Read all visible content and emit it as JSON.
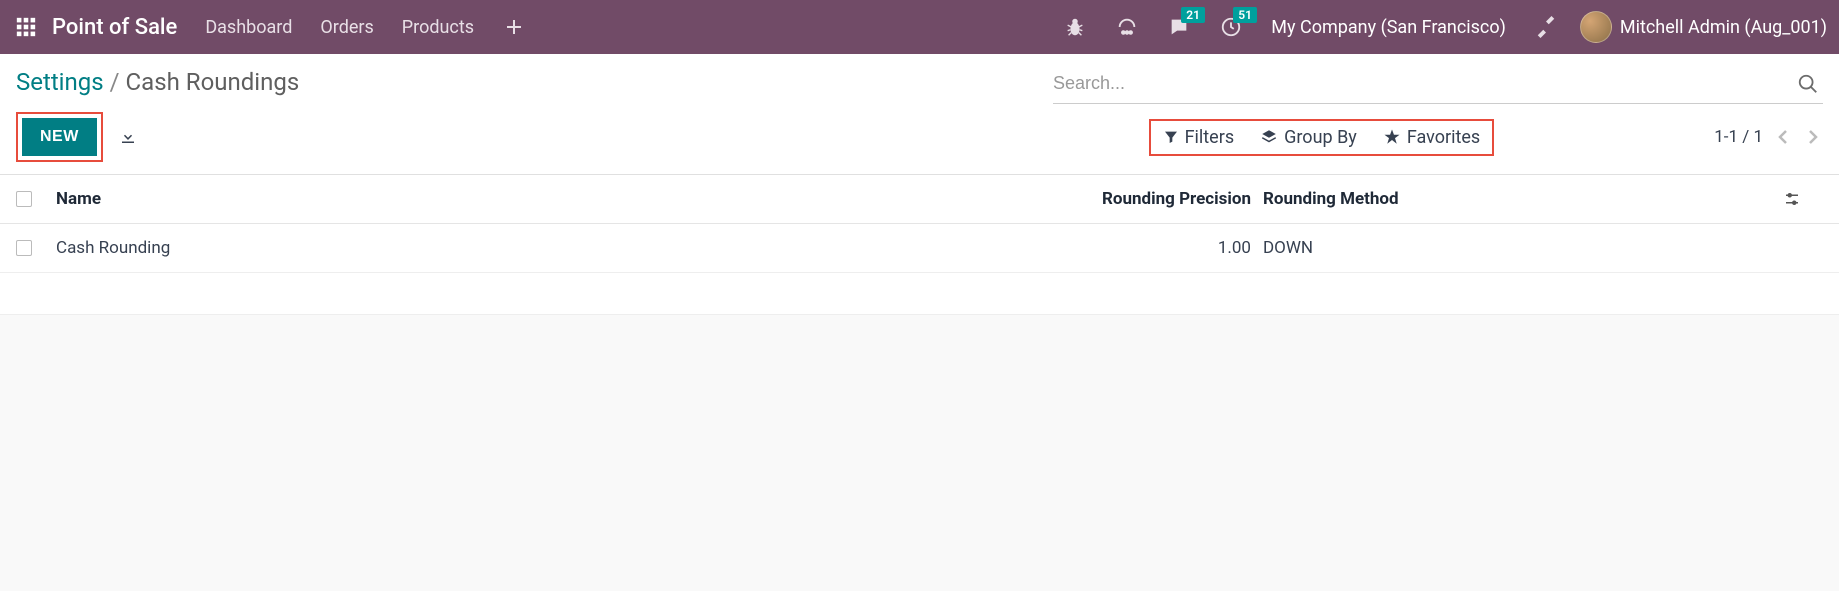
{
  "topnav": {
    "app_title": "Point of Sale",
    "links": [
      "Dashboard",
      "Orders",
      "Products"
    ],
    "messages_badge": "21",
    "activities_badge": "51",
    "company": "My Company (San Francisco)",
    "user_name": "Mitchell Admin (Aug_001)"
  },
  "breadcrumb": {
    "parent": "Settings",
    "current": "Cash Roundings",
    "separator": "/"
  },
  "search": {
    "placeholder": "Search...",
    "value": ""
  },
  "controls": {
    "new_label": "NEW",
    "filters_label": "Filters",
    "groupby_label": "Group By",
    "favorites_label": "Favorites",
    "pager": "1-1 / 1"
  },
  "table": {
    "headers": {
      "name": "Name",
      "precision": "Rounding Precision",
      "method": "Rounding Method"
    },
    "rows": [
      {
        "name": "Cash Rounding",
        "precision": "1.00",
        "method": "DOWN"
      }
    ]
  }
}
